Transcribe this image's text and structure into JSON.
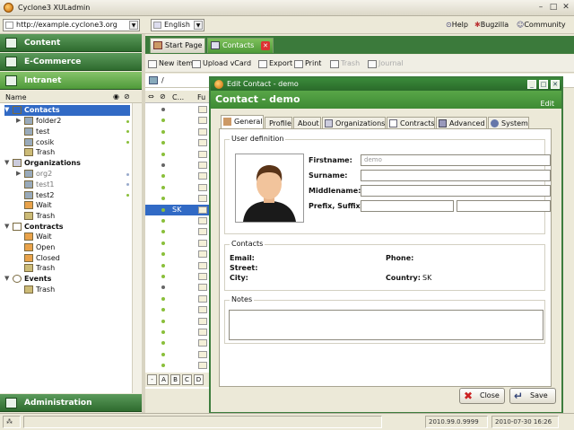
{
  "window": {
    "title": "Cyclone3 XULadmin"
  },
  "toolbar": {
    "url": "http://example.cyclone3.org",
    "language": "English",
    "links": [
      "Help",
      "Bugzilla",
      "Community"
    ]
  },
  "sections": {
    "content": "Content",
    "ecommerce": "E-Commerce",
    "intranet": "Intranet",
    "administration": "Administration"
  },
  "tree": {
    "header_name": "Name",
    "items": [
      {
        "label": "Contacts",
        "bold": true,
        "selected": true
      },
      {
        "label": "folder2"
      },
      {
        "label": "test"
      },
      {
        "label": "cosik"
      },
      {
        "label": "Trash"
      },
      {
        "label": "Organizations",
        "bold": true
      },
      {
        "label": "org2"
      },
      {
        "label": "test1"
      },
      {
        "label": "test2"
      },
      {
        "label": "Wait"
      },
      {
        "label": "Trash"
      },
      {
        "label": "Contracts",
        "bold": true
      },
      {
        "label": "Wait"
      },
      {
        "label": "Open"
      },
      {
        "label": "Closed"
      },
      {
        "label": "Trash"
      },
      {
        "label": "Events",
        "bold": true
      },
      {
        "label": "Trash"
      }
    ]
  },
  "tabs": {
    "start_page": "Start Page",
    "contacts": "Contacts"
  },
  "contacts_toolbar": {
    "new_item": "New item",
    "upload_vcard": "Upload vCard",
    "export": "Export",
    "print": "Print",
    "trash": "Trash",
    "journal": "Journal"
  },
  "path": "/",
  "grid": {
    "col_c": "C...",
    "col_fu": "Fu",
    "selected_value": "SK"
  },
  "alphabet": [
    "-",
    "A",
    "B",
    "C",
    "D"
  ],
  "dialog": {
    "title": "Edit Contact - demo",
    "heading": "Contact - demo",
    "edit_link": "Edit",
    "tabs": [
      "General",
      "Profile",
      "About",
      "Organizations",
      "Contracts",
      "Advanced",
      "System"
    ],
    "user_definition": {
      "legend": "User definition",
      "firstname_label": "Firstname:",
      "firstname_value": "demo",
      "surname_label": "Surname:",
      "middlename_label": "Middlename:",
      "prefix_suffix_label": "Prefix, Suffix:"
    },
    "contacts": {
      "legend": "Contacts",
      "email_label": "Email:",
      "street_label": "Street:",
      "city_label": "City:",
      "phone_label": "Phone:",
      "country_label": "Country:",
      "country_value": "SK"
    },
    "notes": {
      "legend": "Notes"
    },
    "close_button": "Close",
    "save_button": "Save"
  },
  "status": {
    "version": "2010.99.0.9999",
    "datetime": "2010-07-30 16:26"
  }
}
